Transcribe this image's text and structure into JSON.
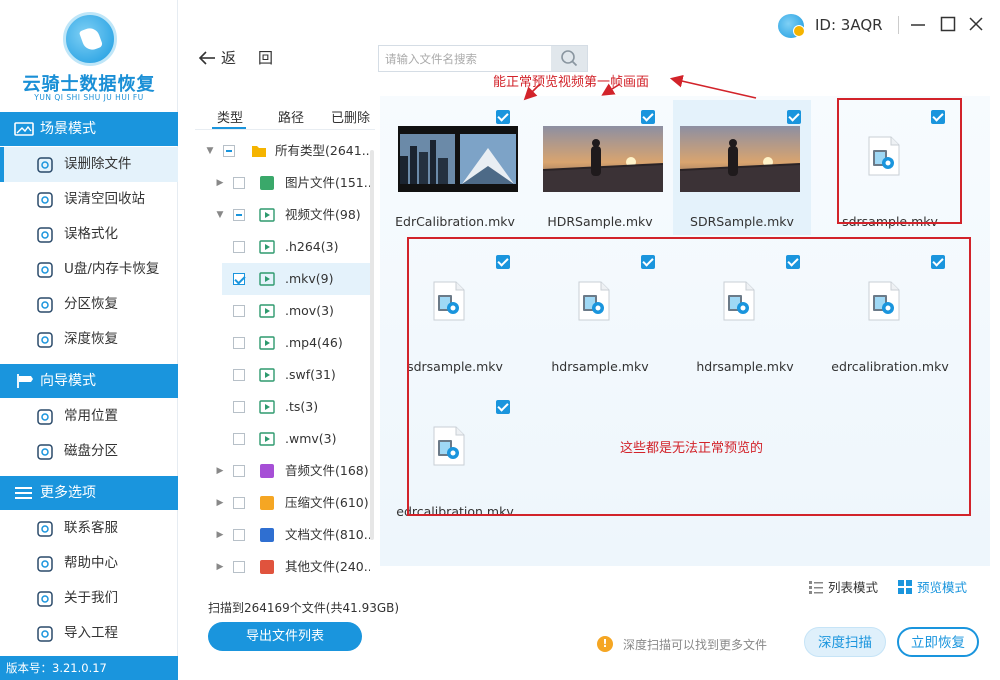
{
  "app": {
    "title": "云骑士数据恢复",
    "subtitle": "YUN QI SHI SHU JU HUI FU",
    "version_label": "版本号：3.21.0.17",
    "user_id": "ID: 3AQR"
  },
  "colors": {
    "primary": "#1a95dd",
    "annotation": "#d2232a",
    "selected_bg": "#e4f2fb"
  },
  "sidebar": {
    "sections": [
      {
        "label": "场景模式",
        "icon": "scene-icon",
        "items": [
          {
            "label": "误删除文件",
            "icon": "deleted-file-icon",
            "active": true
          },
          {
            "label": "误清空回收站",
            "icon": "recycle-bin-icon"
          },
          {
            "label": "误格式化",
            "icon": "format-icon"
          },
          {
            "label": "U盘/内存卡恢复",
            "icon": "usb-icon"
          },
          {
            "label": "分区恢复",
            "icon": "partition-icon"
          },
          {
            "label": "深度恢复",
            "icon": "deep-recovery-icon"
          }
        ]
      },
      {
        "label": "向导模式",
        "icon": "guide-icon",
        "items": [
          {
            "label": "常用位置",
            "icon": "windows-icon"
          },
          {
            "label": "磁盘分区",
            "icon": "disk-icon"
          }
        ]
      },
      {
        "label": "更多选项",
        "icon": "menu-icon",
        "items": [
          {
            "label": "联系客服",
            "icon": "phone-icon"
          },
          {
            "label": "帮助中心",
            "icon": "help-icon"
          },
          {
            "label": "关于我们",
            "icon": "info-icon"
          },
          {
            "label": "导入工程",
            "icon": "import-icon"
          }
        ]
      }
    ]
  },
  "toolbar": {
    "back_label": "返",
    "refresh_label": "回",
    "search_placeholder": "请输入文件名搜索"
  },
  "tree": {
    "tabs": [
      "类型",
      "路径",
      "已删除"
    ],
    "rows": [
      {
        "label": "所有类型(2641...",
        "caret": "▼",
        "check": "partial",
        "icon": "folder-icon",
        "level": 0
      },
      {
        "label": "图片文件(151...",
        "caret": "▶",
        "check": "none",
        "icon": "image-icon",
        "level": 1
      },
      {
        "label": "视频文件(98)",
        "caret": "▼",
        "check": "partial",
        "icon": "video-icon",
        "level": 1
      },
      {
        "label": ".h264(3)",
        "caret": "",
        "check": "none",
        "icon": "video-icon",
        "level": 2
      },
      {
        "label": ".mkv(9)",
        "caret": "",
        "check": "checked",
        "icon": "video-icon",
        "level": 2,
        "selected": true
      },
      {
        "label": ".mov(3)",
        "caret": "",
        "check": "none",
        "icon": "video-icon",
        "level": 2
      },
      {
        "label": ".mp4(46)",
        "caret": "",
        "check": "none",
        "icon": "video-icon",
        "level": 2
      },
      {
        "label": ".swf(31)",
        "caret": "",
        "check": "none",
        "icon": "video-icon",
        "level": 2
      },
      {
        "label": ".ts(3)",
        "caret": "",
        "check": "none",
        "icon": "video-icon",
        "level": 2
      },
      {
        "label": ".wmv(3)",
        "caret": "",
        "check": "none",
        "icon": "video-icon",
        "level": 2
      },
      {
        "label": "音频文件(168)",
        "caret": "▶",
        "check": "none",
        "icon": "audio-icon",
        "level": 1
      },
      {
        "label": "压缩文件(610)",
        "caret": "▶",
        "check": "none",
        "icon": "archive-icon",
        "level": 1
      },
      {
        "label": "文档文件(810...",
        "caret": "▶",
        "check": "none",
        "icon": "document-icon",
        "level": 1
      },
      {
        "label": "其他文件(240...",
        "caret": "▶",
        "check": "none",
        "icon": "other-icon",
        "level": 1
      }
    ]
  },
  "scan_status": "扫描到264169个文件(共41.93GB)",
  "export_label": "导出文件列表",
  "files": [
    {
      "name": "EdrCalibration.mkv",
      "thumb": "city"
    },
    {
      "name": "HDRSample.mkv",
      "thumb": "bridge"
    },
    {
      "name": "SDRSample.mkv",
      "thumb": "bridge"
    },
    {
      "name": "sdrsample.mkv",
      "thumb": "icon"
    },
    {
      "name": "sdrsample.mkv",
      "thumb": "icon"
    },
    {
      "name": "hdrsample.mkv",
      "thumb": "icon"
    },
    {
      "name": "hdrsample.mkv",
      "thumb": "icon"
    },
    {
      "name": "edrcalibration.mkv",
      "thumb": "icon"
    },
    {
      "name": "edrcalibration.mkv",
      "thumb": "icon"
    }
  ],
  "annotations": {
    "top_note": "能正常预览视频第一帧画面",
    "bottom_note": "这些都是无法正常预览的"
  },
  "footer": {
    "list_mode": "列表模式",
    "preview_mode": "预览模式",
    "tip": "深度扫描可以找到更多文件",
    "deep_scan": "深度扫描",
    "recover_now": "立即恢复"
  }
}
